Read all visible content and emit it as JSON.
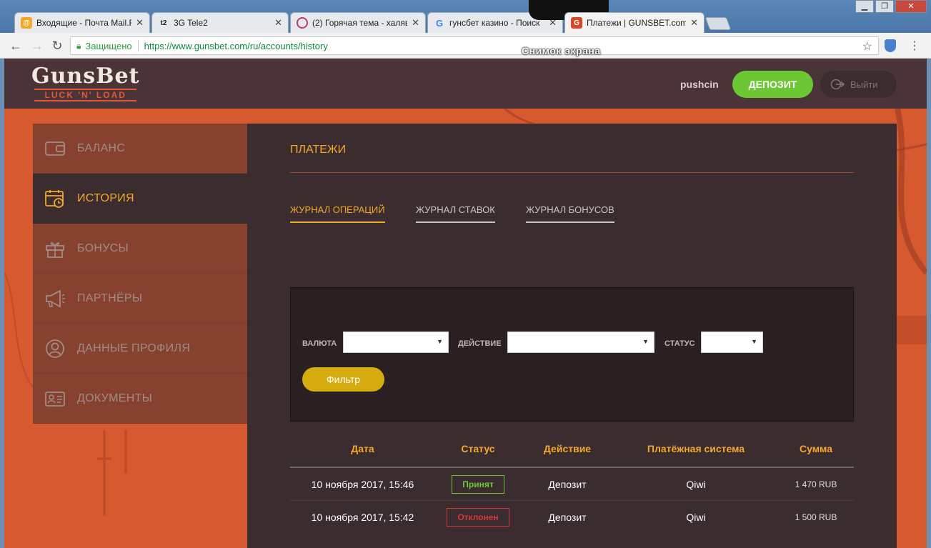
{
  "browser": {
    "tabs": [
      {
        "title": "Входящие - Почта Mail.R",
        "icon": "mail-icon"
      },
      {
        "title": "3G Tele2",
        "icon": "tele2-icon"
      },
      {
        "title": "(2) Горячая тема - халяв",
        "icon": "forum-icon"
      },
      {
        "title": "гунсбет казино - Поиск",
        "icon": "google-icon"
      },
      {
        "title": "Платежи | GUNSBET.com",
        "icon": "gunsbet-icon"
      }
    ],
    "secure_label": "Защищено",
    "url": "https://www.gunsbet.com/ru/accounts/history",
    "window_buttons": [
      "▁",
      "❐",
      "✕"
    ]
  },
  "overlay": {
    "screenshot_label": "Снимок экрана"
  },
  "header": {
    "logo_main": "GunsBet",
    "logo_sub": "LUCK 'N' LOAD",
    "username": "pushcin",
    "deposit_label": "ДЕПОЗИТ",
    "logout_label": "Выйти"
  },
  "sidebar": {
    "items": [
      {
        "label": "БАЛАНС",
        "icon": "wallet-icon"
      },
      {
        "label": "ИСТОРИЯ",
        "icon": "calendar-clock-icon",
        "active": true
      },
      {
        "label": "БОНУСЫ",
        "icon": "gift-icon"
      },
      {
        "label": "ПАРТНЁРЫ",
        "icon": "megaphone-icon"
      },
      {
        "label": "ДАННЫЕ ПРОФИЛЯ",
        "icon": "user-circle-icon"
      },
      {
        "label": "ДОКУМЕНТЫ",
        "icon": "id-card-icon"
      }
    ]
  },
  "main": {
    "title": "ПЛАТЕЖИ",
    "tabs": [
      {
        "label": "ЖУРНАЛ ОПЕРАЦИЙ",
        "active": true
      },
      {
        "label": "ЖУРНАЛ СТАВОК"
      },
      {
        "label": "ЖУРНАЛ БОНУСОВ"
      }
    ],
    "filter": {
      "currency_label": "ВАЛЮТА",
      "action_label": "ДЕЙСТВИЕ",
      "status_label": "СТАТУС",
      "currency_value": "",
      "action_value": "",
      "status_value": "",
      "button_label": "Фильтр"
    },
    "table": {
      "columns": [
        "Дата",
        "Статус",
        "Действие",
        "Платёжная система",
        "Сумма"
      ],
      "rows": [
        {
          "date": "10 ноября 2017, 15:46",
          "status": "Принят",
          "action": "Депозит",
          "system": "Qiwi",
          "amount": "1 470 RUB"
        },
        {
          "date": "10 ноября 2017, 15:42",
          "status": "Отклонен",
          "action": "Депозит",
          "system": "Qiwi",
          "amount": "1 500 RUB"
        }
      ]
    }
  },
  "colors": {
    "accent": "#f3a82a",
    "deposit": "#6bc733",
    "filter_button": "#d4ac0f",
    "rejected": "#d33a34",
    "site_bg": "#d4582e"
  }
}
